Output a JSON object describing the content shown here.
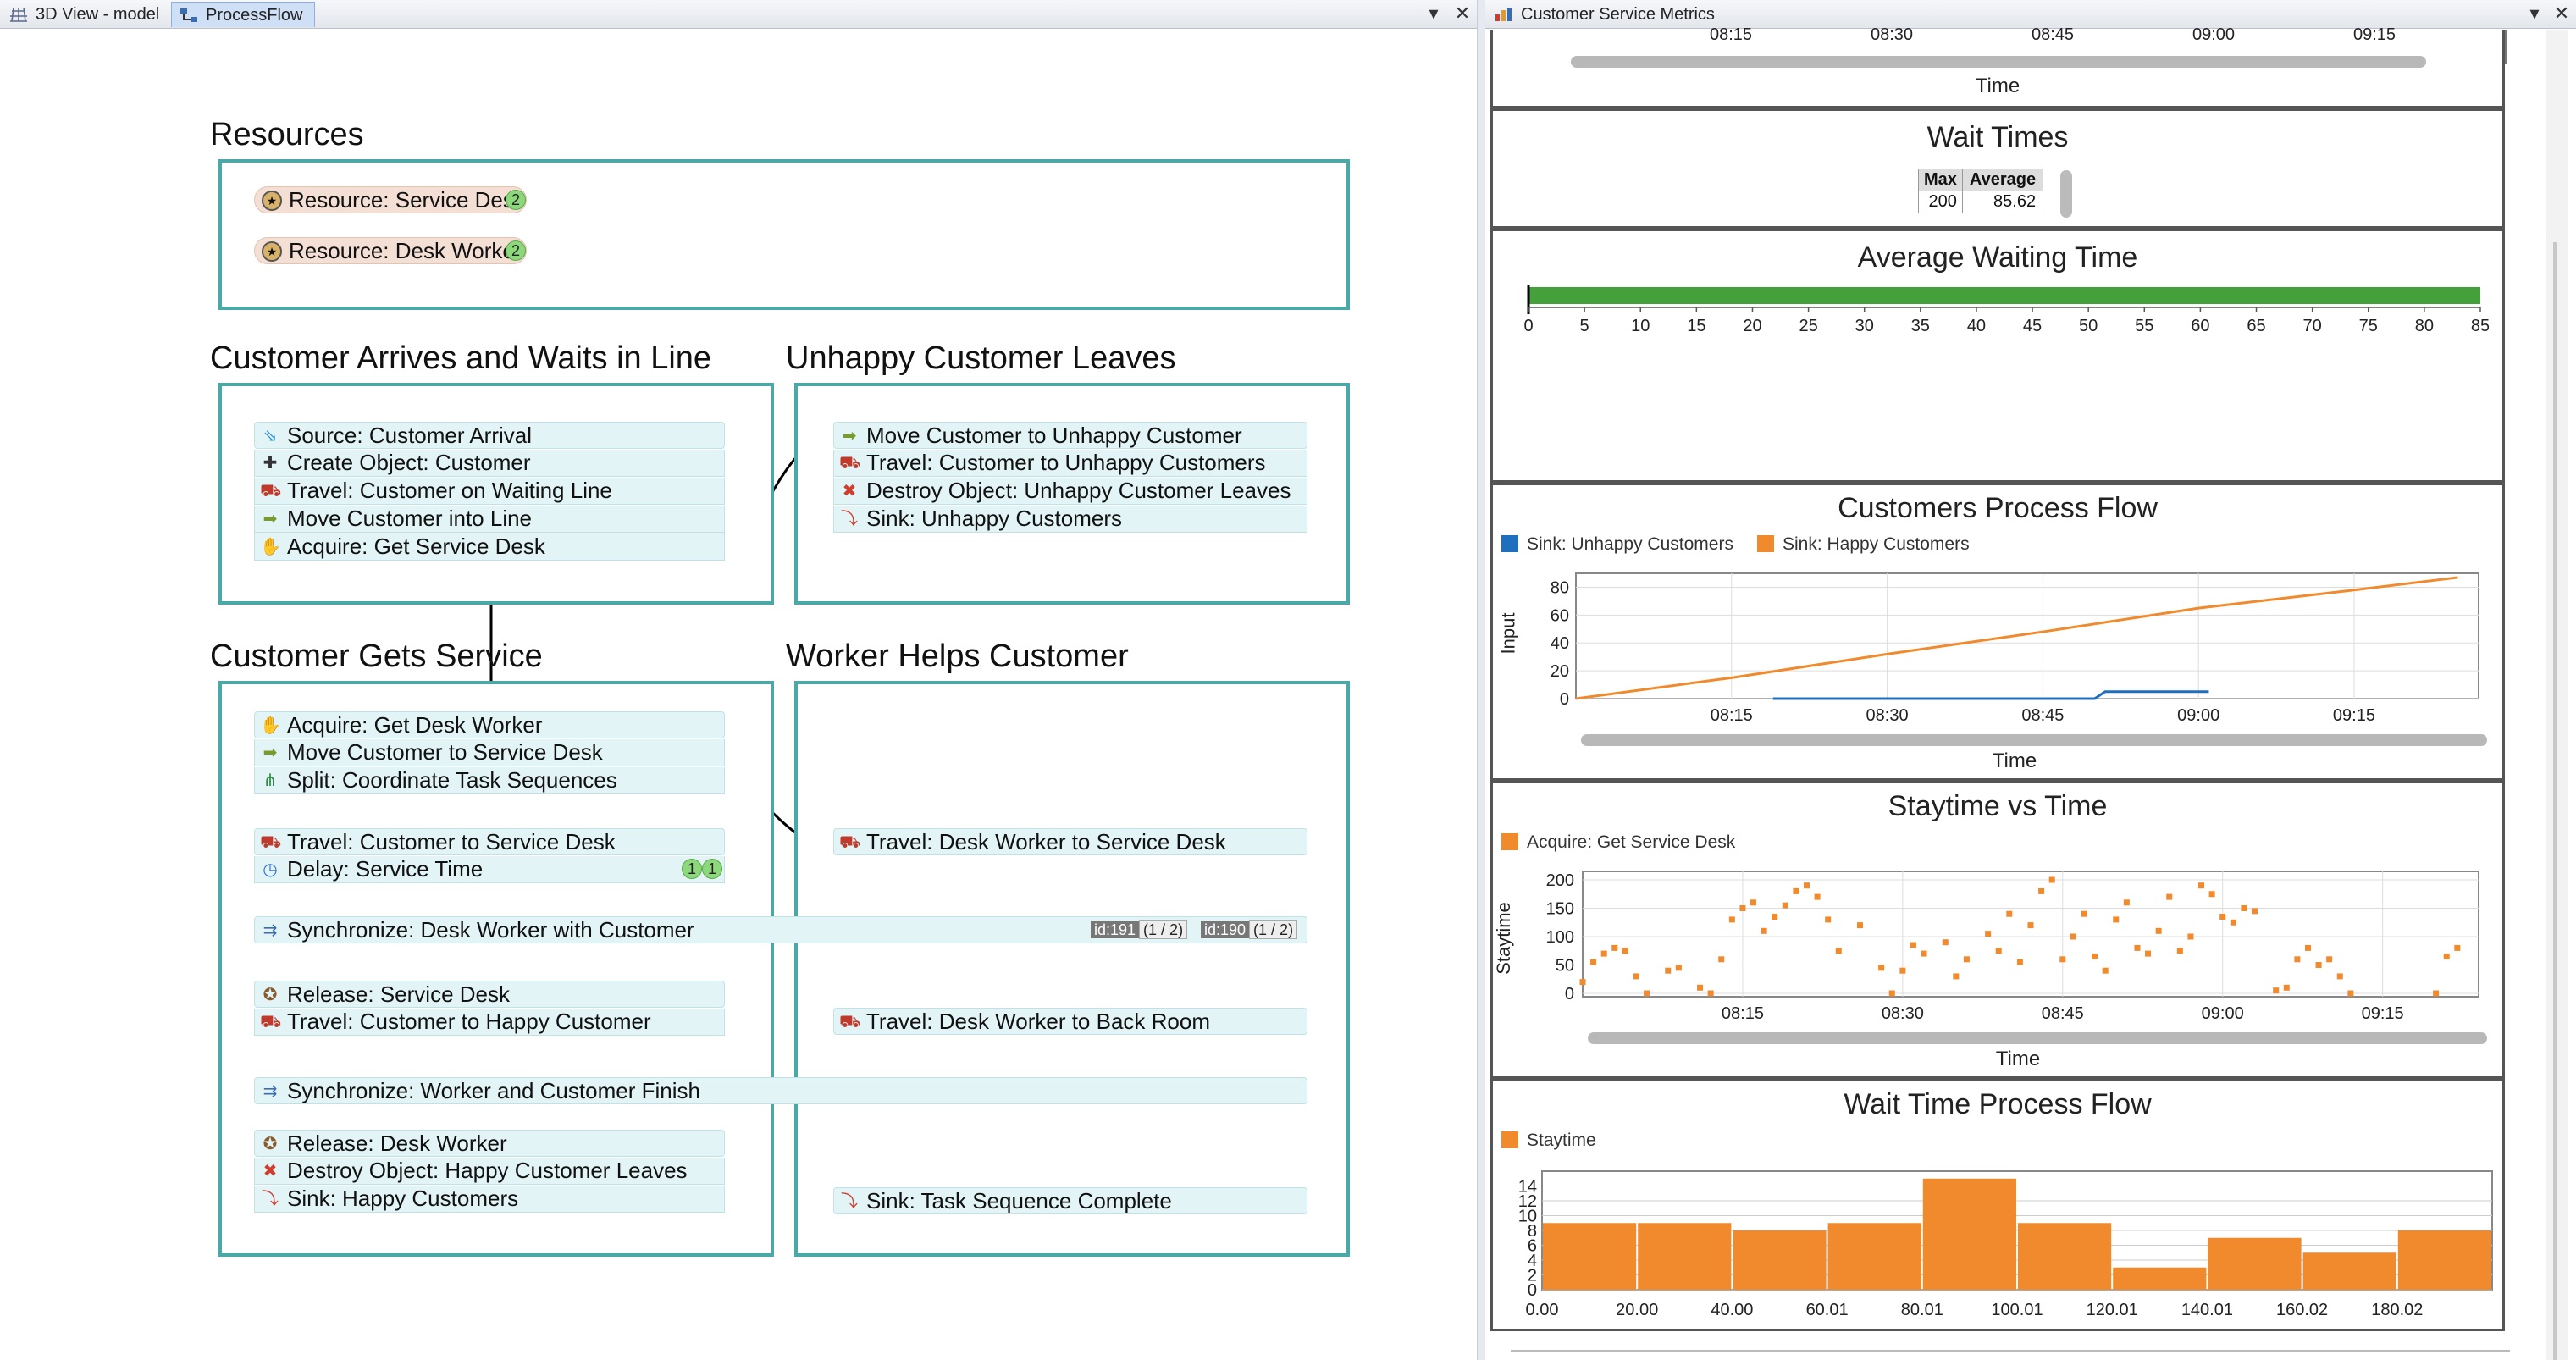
{
  "tabs": {
    "left": [
      {
        "label": "3D View - model",
        "icon": "grid-view-icon"
      },
      {
        "label": "ProcessFlow",
        "icon": "process-flow-icon"
      }
    ],
    "right": {
      "label": "Customer Service Metrics",
      "icon": "dashboard-chart-icon"
    }
  },
  "process_flow": {
    "resources_title": "Resources",
    "resources": [
      {
        "label": "Resource: Service Des",
        "count": "2",
        "icon": "resource-icon"
      },
      {
        "label": "Resource: Desk Worke",
        "count": "2",
        "icon": "resource-icon"
      }
    ],
    "arrive": {
      "title": "Customer Arrives and Waits in Line",
      "items": [
        {
          "label": "Source: Customer Arrival",
          "icon": "source-icon"
        },
        {
          "label": "Create Object: Customer",
          "icon": "create-object-icon"
        },
        {
          "label": "Travel: Customer on Waiting Line",
          "icon": "travel-icon"
        },
        {
          "label": "Move Customer into Line",
          "icon": "move-object-icon"
        },
        {
          "label": "Acquire: Get Service Desk",
          "icon": "acquire-icon"
        }
      ]
    },
    "unhappy": {
      "title": "Unhappy Customer Leaves",
      "items": [
        {
          "label": "Move Customer to Unhappy Customer",
          "icon": "move-object-icon"
        },
        {
          "label": "Travel: Customer to Unhappy Customers",
          "icon": "travel-icon"
        },
        {
          "label": "Destroy Object: Unhappy Customer Leaves",
          "icon": "destroy-object-icon"
        },
        {
          "label": "Sink: Unhappy Customers",
          "icon": "sink-icon"
        }
      ]
    },
    "service": {
      "title": "Customer Gets Service",
      "group1": [
        {
          "label": "Acquire: Get Desk Worker",
          "icon": "acquire-icon"
        },
        {
          "label": "Move Customer to Service Desk",
          "icon": "move-object-icon"
        },
        {
          "label": "Split: Coordinate Task Sequences",
          "icon": "split-icon"
        }
      ],
      "group2": [
        {
          "label": "Travel: Customer to Service Desk",
          "icon": "travel-icon"
        },
        {
          "label": "Delay: Service Time",
          "icon": "delay-icon",
          "tokens": [
            "1",
            "1"
          ]
        }
      ],
      "group3": [
        {
          "label": "Release: Service Desk",
          "icon": "release-icon"
        },
        {
          "label": "Travel: Customer to Happy Customer",
          "icon": "travel-icon"
        }
      ],
      "group4": [
        {
          "label": "Release: Desk Worker",
          "icon": "release-icon"
        },
        {
          "label": "Destroy Object: Happy Customer Leaves",
          "icon": "destroy-object-icon"
        },
        {
          "label": "Sink: Happy Customers",
          "icon": "sink-icon"
        }
      ]
    },
    "worker": {
      "title": "Worker Helps Customer",
      "items": [
        {
          "label": "Travel: Desk Worker to Service Desk",
          "icon": "travel-icon"
        },
        {
          "label": "Travel: Desk Worker to Back Room",
          "icon": "travel-icon"
        },
        {
          "label": "Sink: Task Sequence Complete",
          "icon": "sink-icon"
        }
      ]
    },
    "sync1": {
      "label": "Synchronize: Desk Worker with Customer",
      "icon": "synchronize-icon",
      "tags": [
        {
          "id": "id:191",
          "frac": "(1 / 2)"
        },
        {
          "id": "id:190",
          "frac": "(1 / 2)"
        }
      ]
    },
    "sync2": {
      "label": "Synchronize: Worker and Customer Finish",
      "icon": "synchronize-icon"
    }
  },
  "dashboard": {
    "top_axis": {
      "ticks": [
        "08:15",
        "08:30",
        "08:45",
        "09:00",
        "09:15"
      ],
      "label": "Time"
    },
    "wait_times": {
      "title": "Wait Times",
      "headers": [
        "Max",
        "Average"
      ],
      "values": [
        "200",
        "85.62"
      ]
    },
    "avg_wait": {
      "title": "Average Waiting Time",
      "value": 85.62,
      "ticks": [
        "0",
        "5",
        "10",
        "15",
        "20",
        "25",
        "30",
        "35",
        "40",
        "45",
        "50",
        "55",
        "60",
        "65",
        "70",
        "75",
        "80",
        "85"
      ],
      "bar_color": "#43a03a"
    },
    "process_flow_chart": {
      "title": "Customers Process Flow",
      "ylabel": "Input",
      "xlabel": "Time",
      "legend": [
        {
          "name": "Sink: Unhappy Customers",
          "color": "#1f6fbf"
        },
        {
          "name": "Sink: Happy Customers",
          "color": "#f08a2c"
        }
      ],
      "yticks": [
        "80",
        "60",
        "40",
        "20",
        "0"
      ],
      "xticks": [
        "08:15",
        "08:30",
        "08:45",
        "09:00",
        "09:15"
      ]
    },
    "staytime": {
      "title": "Staytime vs Time",
      "ylabel": "Staytime",
      "xlabel": "Time",
      "legend": [
        {
          "name": "Acquire: Get Service Desk",
          "color": "#f08a2c"
        }
      ],
      "yticks": [
        "200",
        "150",
        "100",
        "50",
        "0"
      ],
      "xticks": [
        "08:15",
        "08:30",
        "08:45",
        "09:00",
        "09:15"
      ]
    },
    "histogram": {
      "title": "Wait Time Process Flow",
      "legend": [
        {
          "name": "Staytime",
          "color": "#f08a2c"
        }
      ],
      "yticks": [
        "14",
        "12",
        "10",
        "8",
        "6",
        "4",
        "2",
        "0"
      ],
      "xticks": [
        "0.00",
        "20.00",
        "40.00",
        "60.01",
        "80.01",
        "100.01",
        "120.01",
        "140.01",
        "160.02",
        "180.02"
      ]
    }
  },
  "chart_data": [
    {
      "type": "line",
      "title": "Customers Process Flow",
      "xlabel": "Time",
      "ylabel": "Input",
      "ylim": [
        0,
        90
      ],
      "x_range": [
        "08:00",
        "09:27"
      ],
      "series": [
        {
          "name": "Sink: Happy Customers",
          "x": [
            "08:00",
            "08:15",
            "08:30",
            "08:45",
            "09:00",
            "09:15",
            "09:25"
          ],
          "values": [
            0,
            15,
            32,
            48,
            65,
            78,
            87
          ]
        },
        {
          "name": "Sink: Unhappy Customers",
          "x": [
            "08:19",
            "08:50",
            "08:51",
            "09:01"
          ],
          "values": [
            0,
            0,
            5,
            5
          ]
        }
      ]
    },
    {
      "type": "scatter",
      "title": "Staytime vs Time",
      "xlabel": "Time",
      "ylabel": "Staytime",
      "ylim": [
        0,
        210
      ],
      "series": [
        {
          "name": "Acquire: Get Service Desk",
          "x": [
            "08:00",
            "08:01",
            "08:02",
            "08:03",
            "08:04",
            "08:05",
            "08:06",
            "08:08",
            "08:09",
            "08:11",
            "08:12",
            "08:13",
            "08:14",
            "08:15",
            "08:16",
            "08:17",
            "08:18",
            "08:19",
            "08:20",
            "08:21",
            "08:22",
            "08:23",
            "08:24",
            "08:26",
            "08:28",
            "08:29",
            "08:30",
            "08:31",
            "08:32",
            "08:34",
            "08:35",
            "08:36",
            "08:38",
            "08:39",
            "08:40",
            "08:41",
            "08:42",
            "08:43",
            "08:44",
            "08:45",
            "08:46",
            "08:47",
            "08:48",
            "08:49",
            "08:50",
            "08:51",
            "08:52",
            "08:53",
            "08:54",
            "08:55",
            "08:56",
            "08:57",
            "08:58",
            "08:59",
            "09:00",
            "09:01",
            "09:02",
            "09:03",
            "09:05",
            "09:06",
            "09:07",
            "09:08",
            "09:09",
            "09:10",
            "09:11",
            "09:12",
            "09:20",
            "09:21",
            "09:22"
          ],
          "values": [
            20,
            55,
            70,
            80,
            75,
            30,
            0,
            40,
            45,
            10,
            0,
            60,
            130,
            150,
            160,
            110,
            135,
            155,
            180,
            190,
            170,
            130,
            75,
            120,
            45,
            0,
            40,
            85,
            70,
            90,
            30,
            60,
            105,
            75,
            140,
            55,
            120,
            180,
            200,
            60,
            100,
            140,
            65,
            40,
            130,
            160,
            80,
            70,
            110,
            170,
            75,
            100,
            190,
            175,
            135,
            125,
            150,
            145,
            5,
            10,
            60,
            80,
            50,
            60,
            30,
            0,
            0,
            65,
            80
          ]
        }
      ]
    },
    {
      "type": "bar",
      "title": "Wait Time Process Flow",
      "categories": [
        "0.00",
        "20.00",
        "40.00",
        "60.01",
        "80.01",
        "100.01",
        "120.01",
        "140.01",
        "160.02",
        "180.02"
      ],
      "series": [
        {
          "name": "Staytime",
          "values": [
            9,
            9,
            8,
            9,
            15,
            9,
            3,
            7,
            5,
            8
          ]
        }
      ],
      "ylim": [
        0,
        16
      ]
    }
  ]
}
